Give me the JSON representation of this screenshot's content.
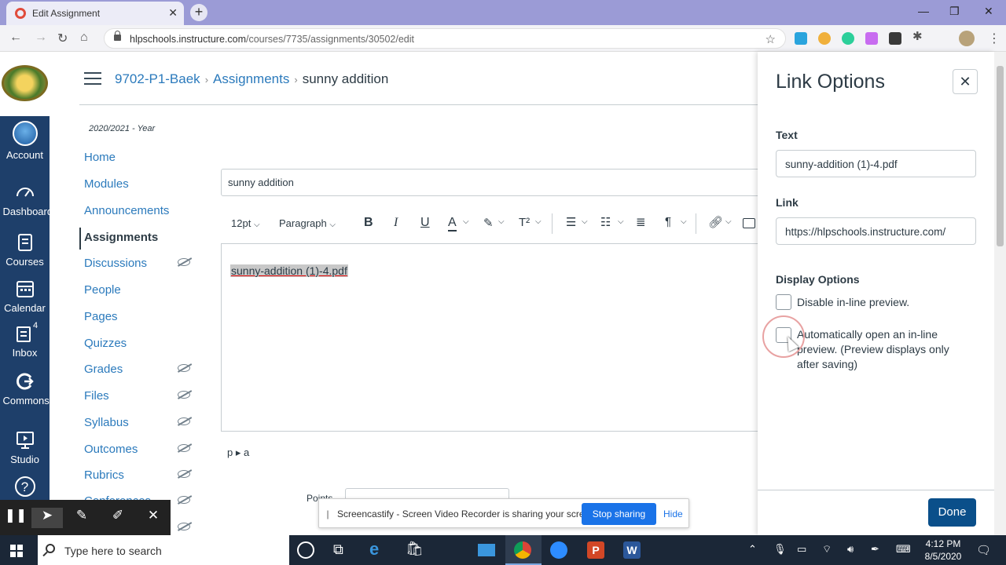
{
  "browser": {
    "tab_title": "Edit Assignment",
    "url_host": "hlpschools.instructure.com",
    "url_path": "/courses/7735/assignments/30502/edit"
  },
  "global_nav": {
    "items": [
      {
        "label": "Account",
        "icon": "avatar-icon"
      },
      {
        "label": "Dashboard",
        "icon": "dashboard-icon"
      },
      {
        "label": "Courses",
        "icon": "courses-icon"
      },
      {
        "label": "Calendar",
        "icon": "calendar-icon"
      },
      {
        "label": "Inbox",
        "icon": "inbox-icon",
        "badge": "4"
      },
      {
        "label": "Commons",
        "icon": "commons-icon"
      },
      {
        "label": "Studio",
        "icon": "studio-icon"
      },
      {
        "label": "?",
        "icon": "help-icon"
      }
    ]
  },
  "breadcrumb": {
    "course": "9702-P1-Baek",
    "section": "Assignments",
    "current": "sunny addition"
  },
  "course_nav": {
    "term": "2020/2021 - Year",
    "items": [
      {
        "label": "Home"
      },
      {
        "label": "Modules"
      },
      {
        "label": "Announcements"
      },
      {
        "label": "Assignments"
      },
      {
        "label": "Discussions"
      },
      {
        "label": "People"
      },
      {
        "label": "Pages"
      },
      {
        "label": "Quizzes"
      },
      {
        "label": "Grades"
      },
      {
        "label": "Files"
      },
      {
        "label": "Syllabus"
      },
      {
        "label": "Outcomes"
      },
      {
        "label": "Rubrics"
      },
      {
        "label": "Conferences"
      }
    ]
  },
  "editor": {
    "title_value": "sunny addition",
    "font_size": "12pt",
    "block_format": "Paragraph",
    "body_link_text": "sunny-addition (1)-4.pdf",
    "path": "p ▸ a",
    "points_label": "Points"
  },
  "link_options": {
    "title": "Link Options",
    "text_label": "Text",
    "text_value": "sunny-addition (1)-4.pdf",
    "link_label": "Link",
    "link_value": "https://hlpschools.instructure.com/",
    "display_label": "Display Options",
    "option_disable": "Disable in-line preview.",
    "option_auto": "Automatically open an in-line preview. (Preview displays only after saving)",
    "done_label": "Done"
  },
  "screencastify": {
    "message": "Screencastify - Screen Video Recorder is sharing your screen.",
    "stop_label": "Stop sharing",
    "hide_label": "Hide"
  },
  "taskbar": {
    "search_placeholder": "Type here to search",
    "time": "4:12 PM",
    "date": "8/5/2020"
  },
  "colors": {
    "canvas_nav": "#1e3f6a",
    "link": "#2b7abc",
    "done_button": "#0a4f8a",
    "stop_button": "#1a73e8"
  }
}
